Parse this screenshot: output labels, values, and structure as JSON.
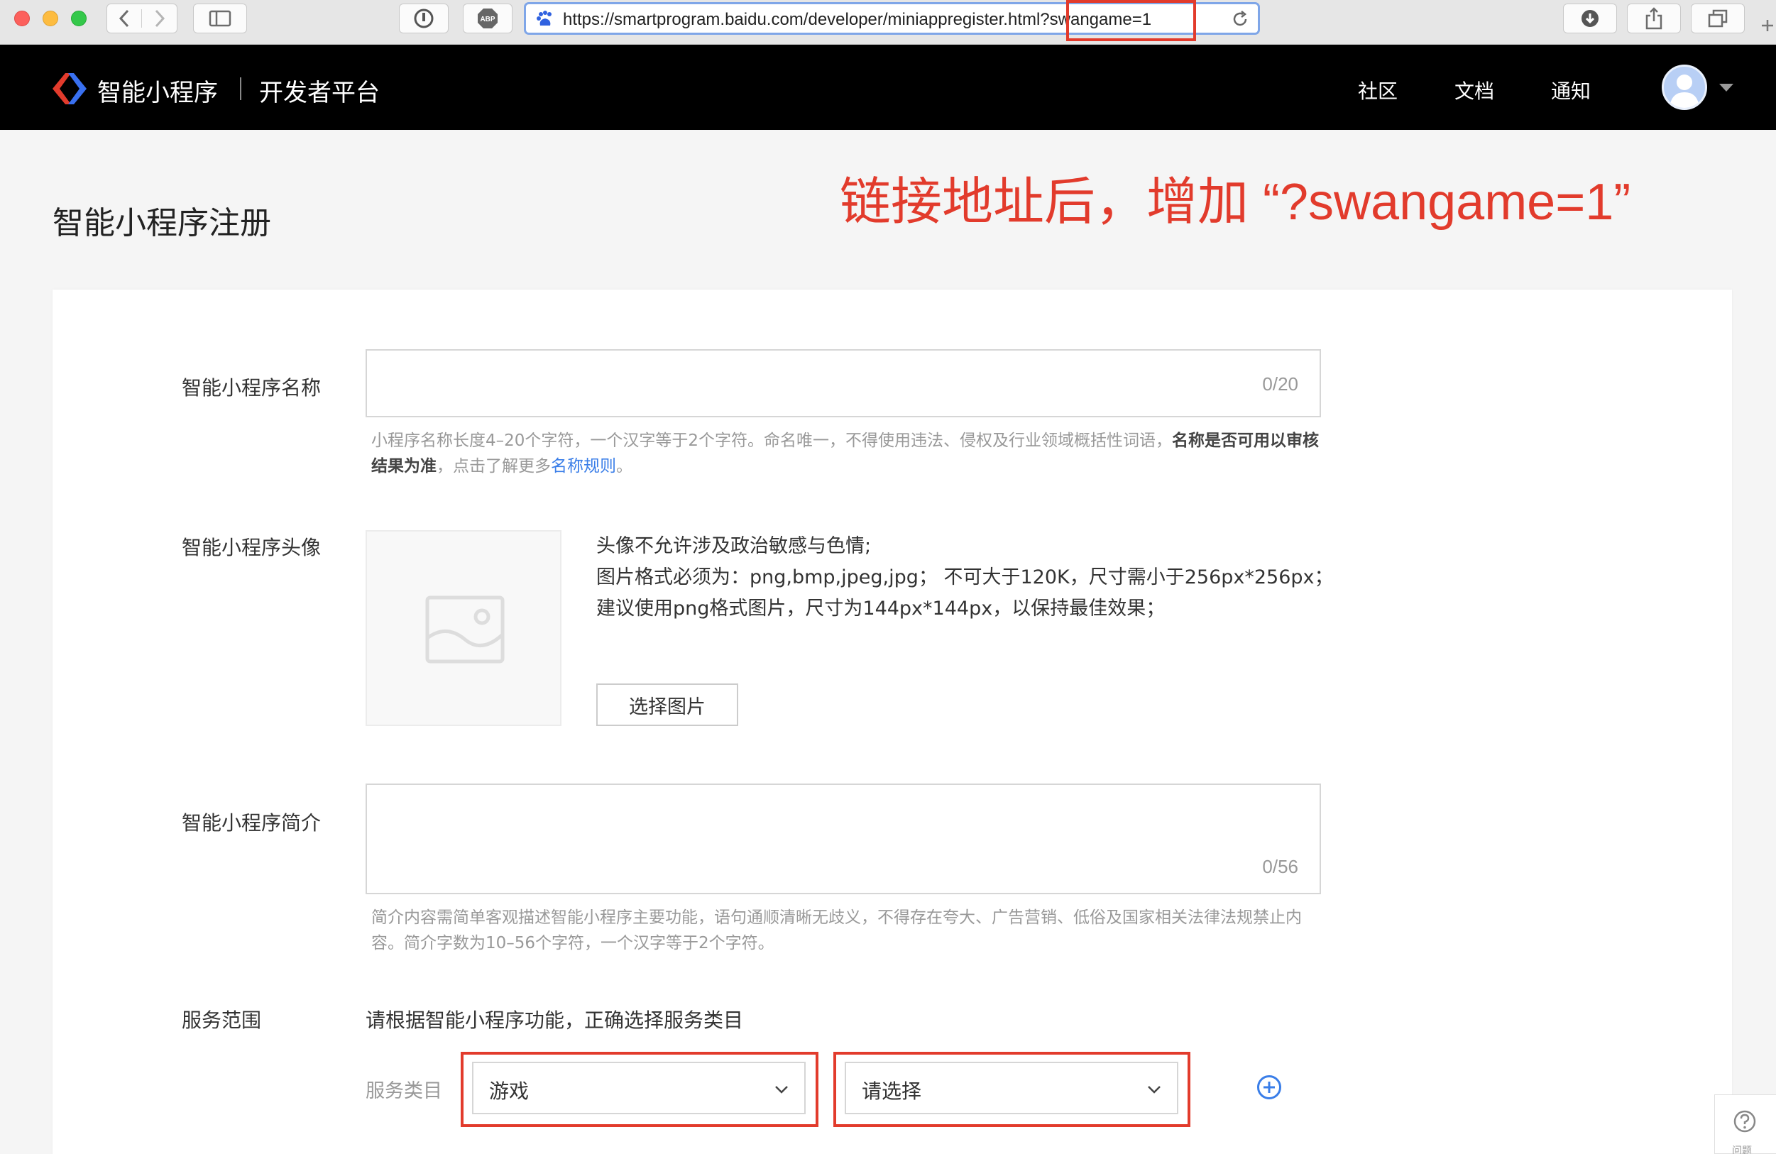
{
  "browser": {
    "url": "https://smartprogram.baidu.com/developer/miniappregister.html?swangame=1"
  },
  "navbar": {
    "brand": "智能小程序",
    "subtitle": "开发者平台",
    "links": [
      "社区",
      "文档",
      "通知"
    ]
  },
  "page": {
    "title": "智能小程序注册",
    "annotation": "链接地址后，增加 “?swangame=1”"
  },
  "form": {
    "name": {
      "label": "智能小程序名称",
      "counter": "0/20",
      "hint_main": "小程序名称长度4–20个字符，一个汉字等于2个字符。命名唯一，不得使用违法、侵权及行业领域概括性词语，",
      "hint_bold": "名称是否可用以审核结果为准",
      "hint_tail": "，点击了解更多",
      "hint_link": "名称规则",
      "hint_end": "。"
    },
    "avatar": {
      "label": "智能小程序头像",
      "req1": "头像不允许涉及政治敏感与色情;",
      "req2": "图片格式必须为：png,bmp,jpeg,jpg；  不可大于120K，尺寸需小于256px*256px；建议使用png格式图片，尺寸为144px*144px，以保持最佳效果；",
      "button": "选择图片"
    },
    "intro": {
      "label": "智能小程序简介",
      "counter": "0/56",
      "hint": "简介内容需简单客观描述智能小程序主要功能，语句通顺清晰无歧义，不得存在夸大、广告营销、低俗及国家相关法律法规禁止内容。简介字数为10–56个字符，一个汉字等于2个字符。"
    },
    "service": {
      "label": "服务范围",
      "description": "请根据智能小程序功能，正确选择服务类目",
      "category_label": "服务类目",
      "select1_value": "游戏",
      "select2_placeholder": "请选择"
    }
  },
  "help": {
    "label": "问题"
  }
}
